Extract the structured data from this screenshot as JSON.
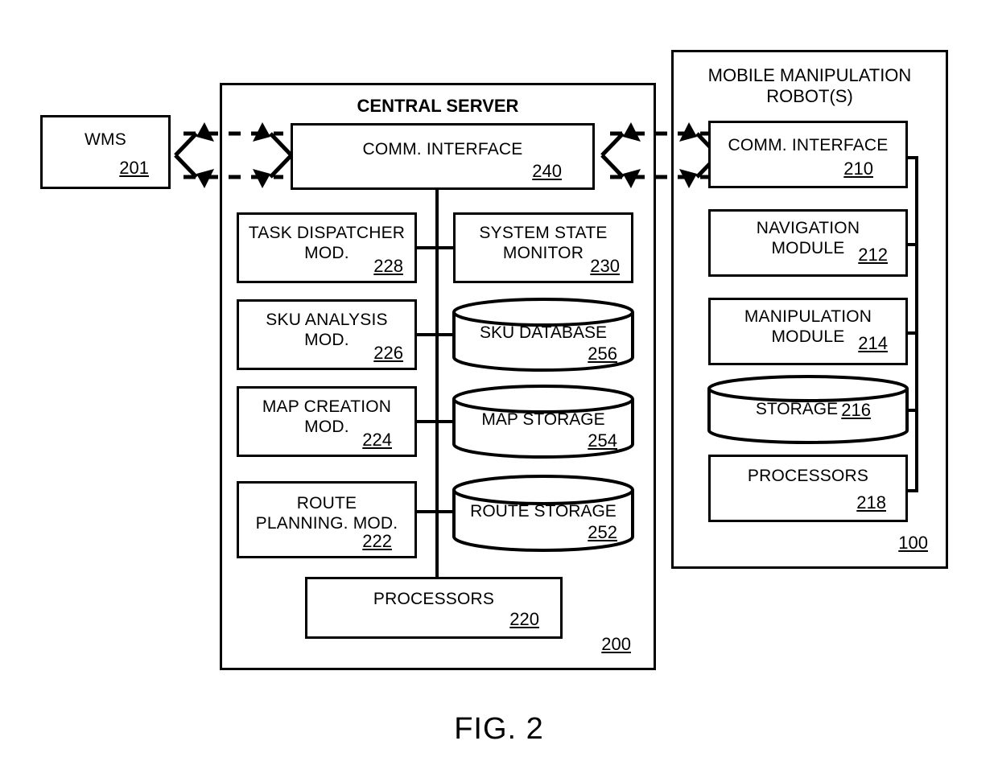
{
  "figure": {
    "caption": "FIG. 2"
  },
  "wms": {
    "label": "WMS",
    "ref": "201"
  },
  "central_server": {
    "title": "CENTRAL SERVER",
    "ref": "200",
    "comm_interface": {
      "label": "COMM. INTERFACE",
      "ref": "240"
    },
    "left_modules": [
      {
        "label": "TASK DISPATCHER\nMOD.",
        "ref": "228"
      },
      {
        "label": "SKU ANALYSIS\nMOD.",
        "ref": "226"
      },
      {
        "label": "MAP CREATION\nMOD.",
        "ref": "224"
      },
      {
        "label": "ROUTE\nPLANNING. MOD.",
        "ref": "222"
      }
    ],
    "right_modules": [
      {
        "label": "SYSTEM STATE\nMONITOR",
        "ref": "230",
        "shape": "box"
      },
      {
        "label": "SKU DATABASE",
        "ref": "256",
        "shape": "cylinder"
      },
      {
        "label": "MAP STORAGE",
        "ref": "254",
        "shape": "cylinder"
      },
      {
        "label": "ROUTE STORAGE",
        "ref": "252",
        "shape": "cylinder"
      }
    ],
    "processors": {
      "label": "PROCESSORS",
      "ref": "220"
    }
  },
  "robot": {
    "title": "MOBILE MANIPULATION\nROBOT(S)",
    "ref": "100",
    "modules": [
      {
        "label": "COMM. INTERFACE",
        "ref": "210",
        "shape": "box"
      },
      {
        "label": "NAVIGATION\nMODULE",
        "ref": "212",
        "shape": "box"
      },
      {
        "label": "MANIPULATION\nMODULE",
        "ref": "214",
        "shape": "box"
      },
      {
        "label": "STORAGE",
        "ref": "216",
        "shape": "cylinder"
      },
      {
        "label": "PROCESSORS",
        "ref": "218",
        "shape": "box"
      }
    ]
  },
  "links": [
    {
      "from": "wms",
      "to": "central_server_comm_interface",
      "style": "dashed-bidirectional"
    },
    {
      "from": "central_server_comm_interface",
      "to": "robot_comm_interface",
      "style": "dashed-bidirectional"
    }
  ],
  "colors": {
    "stroke": "#000000",
    "background": "#ffffff"
  }
}
